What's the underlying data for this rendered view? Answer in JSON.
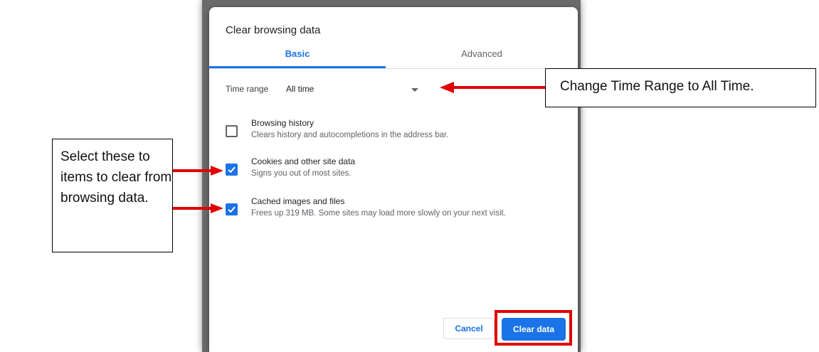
{
  "dialog": {
    "title": "Clear browsing data",
    "tabs": [
      {
        "label": "Basic",
        "selected": true
      },
      {
        "label": "Advanced",
        "selected": false
      }
    ],
    "time_range": {
      "label": "Time range",
      "value": "All time"
    },
    "items": [
      {
        "title": "Browsing history",
        "description": "Clears history and autocompletions in the address bar.",
        "checked": false
      },
      {
        "title": "Cookies and other site data",
        "description": "Signs you out of most sites.",
        "checked": true
      },
      {
        "title": "Cached images and files",
        "description": "Frees up 319 MB. Some sites may load more slowly on your next visit.",
        "checked": true
      }
    ],
    "buttons": {
      "cancel": "Cancel",
      "clear": "Clear data"
    }
  },
  "annotations": {
    "time_range_callout": "Change Time Range to All Time.",
    "items_callout": "Select these to items to clear from browsing data."
  },
  "colors": {
    "accent": "#1a73e8",
    "annotation_red": "#e00000"
  }
}
